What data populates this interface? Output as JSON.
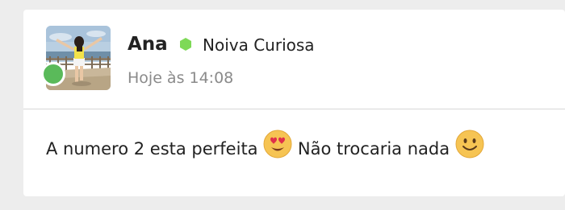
{
  "post": {
    "author": {
      "name": "Ana",
      "role": "Noiva Curiosa",
      "status": "online",
      "badge_color": "#7ed957"
    },
    "timestamp": "Hoje às 14:08",
    "message": {
      "part1": "A numero 2 esta perfeita",
      "emoji1": "heart-eyes-emoji",
      "part2": "Não trocaria nada",
      "emoji2": "smiling-face-emoji"
    }
  },
  "colors": {
    "background": "#ededed",
    "card": "#ffffff",
    "online_dot": "#5aba5a",
    "timestamp": "#8a8a8a",
    "divider": "#d6d6d6"
  }
}
